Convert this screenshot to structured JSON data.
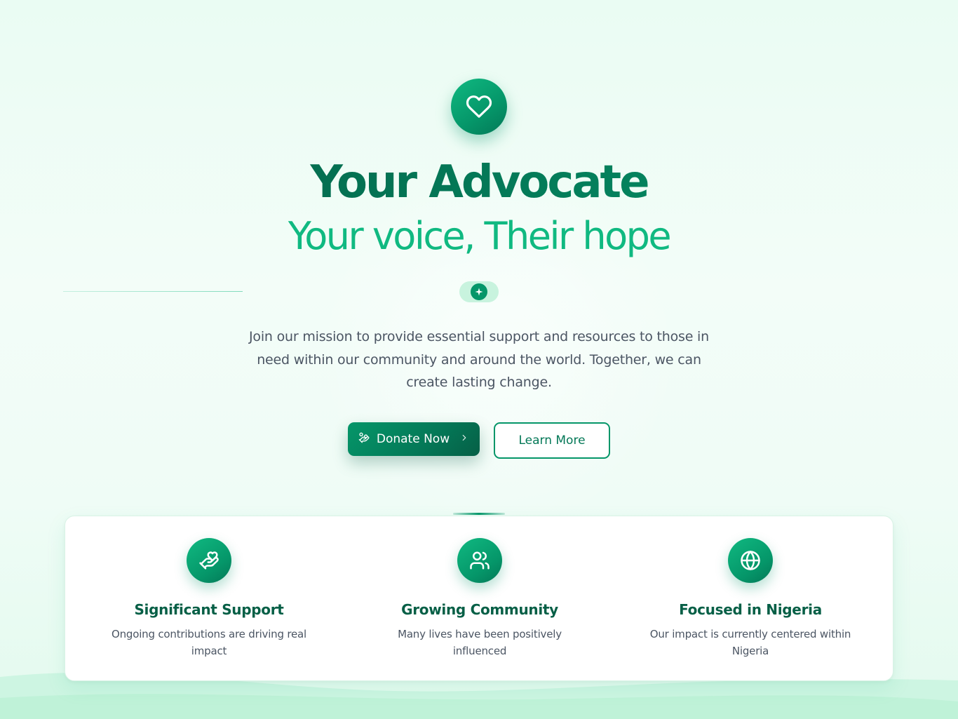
{
  "hero": {
    "icon": "heart-icon",
    "title": "Your Advocate",
    "subtitle": "Your voice, Their hope",
    "sparkle_icon": "sparkle-icon",
    "description": "Join our mission to provide essential support and resources to those in need within our community and around the world. Together, we can create lasting change."
  },
  "actions": {
    "donate_label": "Donate Now",
    "donate_icon": "hand-coins-icon",
    "donate_chevron": "chevron-right-icon",
    "learn_label": "Learn More"
  },
  "stats": [
    {
      "icon": "heart-handshake-icon",
      "title": "Significant Support",
      "description": "Ongoing contributions are driving real impact"
    },
    {
      "icon": "users-icon",
      "title": "Growing Community",
      "description": "Many lives have been positively influenced"
    },
    {
      "icon": "globe-icon",
      "title": "Focused in Nigeria",
      "description": "Our impact is currently centered within Nigeria"
    }
  ],
  "colors": {
    "primary": "#059669",
    "primary_dark": "#065f46",
    "accent": "#10b981",
    "background": "#eafcf3",
    "text_muted": "#4b5563"
  }
}
